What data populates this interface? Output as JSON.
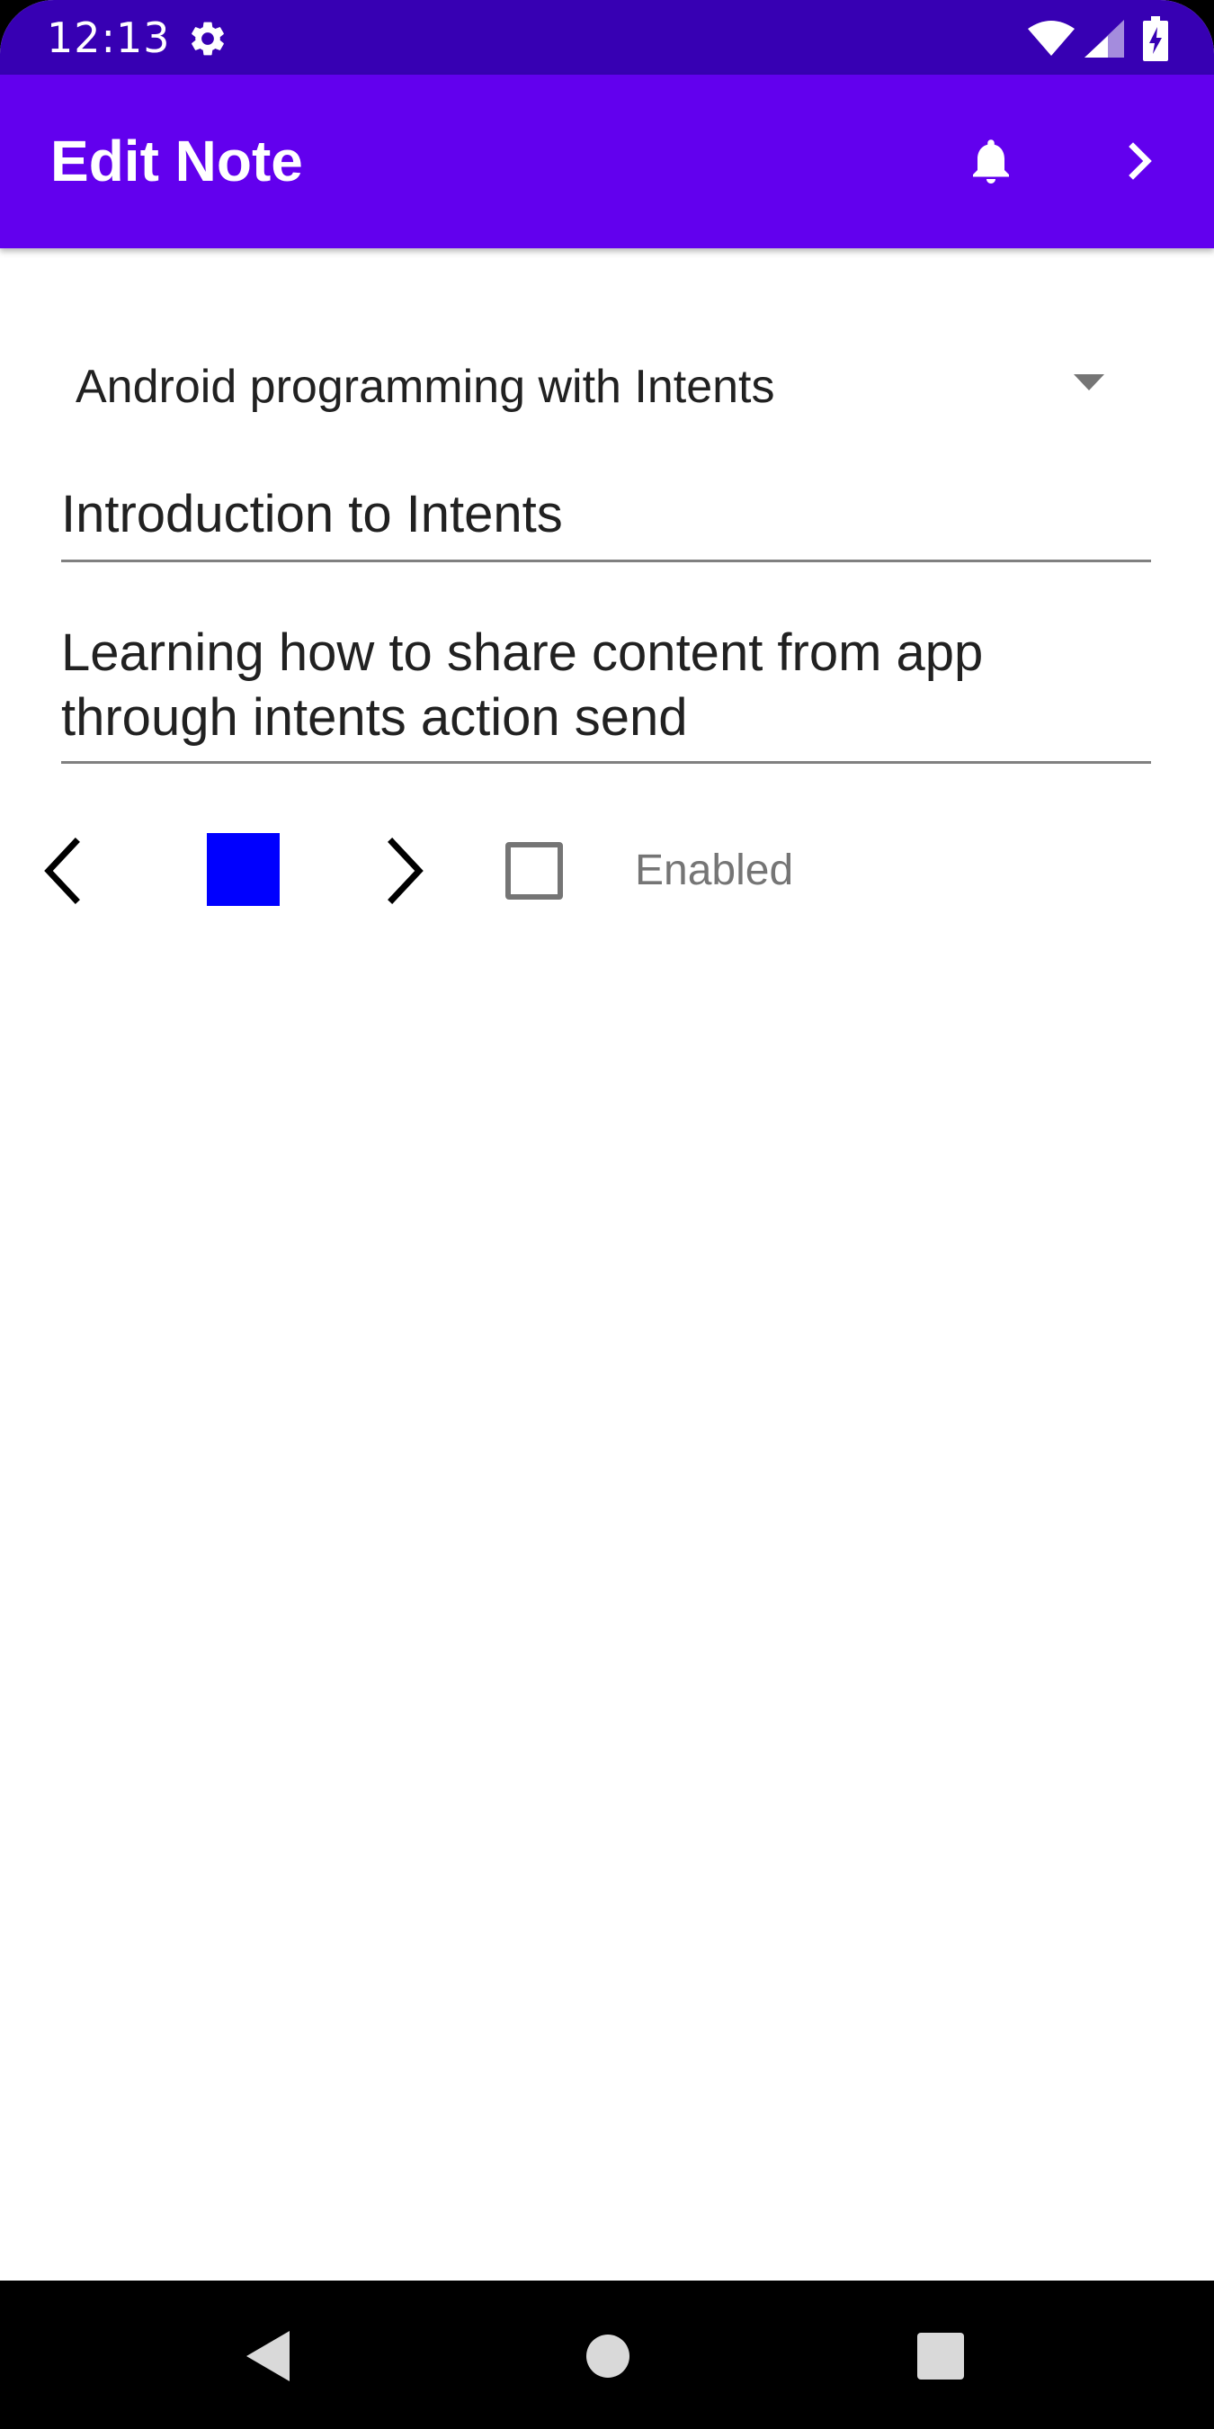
{
  "status_bar": {
    "time": "12:13",
    "icons": [
      "gear-icon",
      "wifi-icon",
      "signal-icon",
      "battery-charging-icon"
    ],
    "background": "#3700b3"
  },
  "app_bar": {
    "title": "Edit Note",
    "actions": [
      "bell-icon",
      "chevron-right-icon"
    ],
    "background": "#6200ee"
  },
  "form": {
    "course_spinner": {
      "selected": "Android programming with Intents"
    },
    "note_title": {
      "value": "Introduction to Intents"
    },
    "note_text": {
      "value": "Learning how to share content from app through intents action send"
    },
    "color_selector": {
      "color": "#0000ff",
      "prev_icon": "chevron-left-icon",
      "next_icon": "chevron-right-icon"
    },
    "enabled_checkbox": {
      "label": "Enabled",
      "checked": false
    }
  },
  "nav_bar": {
    "buttons": [
      "back-icon",
      "home-icon",
      "recents-icon"
    ]
  }
}
